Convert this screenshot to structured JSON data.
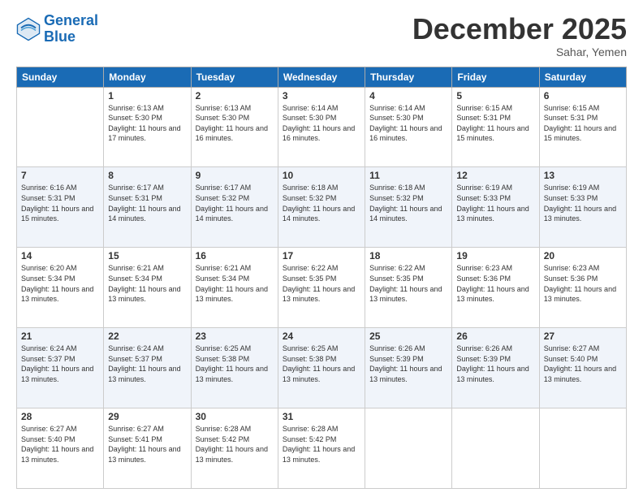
{
  "logo": {
    "line1": "General",
    "line2": "Blue"
  },
  "title": "December 2025",
  "subtitle": "Sahar, Yemen",
  "headers": [
    "Sunday",
    "Monday",
    "Tuesday",
    "Wednesday",
    "Thursday",
    "Friday",
    "Saturday"
  ],
  "weeks": [
    [
      {
        "day": "",
        "sunrise": "",
        "sunset": "",
        "daylight": ""
      },
      {
        "day": "1",
        "sunrise": "Sunrise: 6:13 AM",
        "sunset": "Sunset: 5:30 PM",
        "daylight": "Daylight: 11 hours and 17 minutes."
      },
      {
        "day": "2",
        "sunrise": "Sunrise: 6:13 AM",
        "sunset": "Sunset: 5:30 PM",
        "daylight": "Daylight: 11 hours and 16 minutes."
      },
      {
        "day": "3",
        "sunrise": "Sunrise: 6:14 AM",
        "sunset": "Sunset: 5:30 PM",
        "daylight": "Daylight: 11 hours and 16 minutes."
      },
      {
        "day": "4",
        "sunrise": "Sunrise: 6:14 AM",
        "sunset": "Sunset: 5:30 PM",
        "daylight": "Daylight: 11 hours and 16 minutes."
      },
      {
        "day": "5",
        "sunrise": "Sunrise: 6:15 AM",
        "sunset": "Sunset: 5:31 PM",
        "daylight": "Daylight: 11 hours and 15 minutes."
      },
      {
        "day": "6",
        "sunrise": "Sunrise: 6:15 AM",
        "sunset": "Sunset: 5:31 PM",
        "daylight": "Daylight: 11 hours and 15 minutes."
      }
    ],
    [
      {
        "day": "7",
        "sunrise": "Sunrise: 6:16 AM",
        "sunset": "Sunset: 5:31 PM",
        "daylight": "Daylight: 11 hours and 15 minutes."
      },
      {
        "day": "8",
        "sunrise": "Sunrise: 6:17 AM",
        "sunset": "Sunset: 5:31 PM",
        "daylight": "Daylight: 11 hours and 14 minutes."
      },
      {
        "day": "9",
        "sunrise": "Sunrise: 6:17 AM",
        "sunset": "Sunset: 5:32 PM",
        "daylight": "Daylight: 11 hours and 14 minutes."
      },
      {
        "day": "10",
        "sunrise": "Sunrise: 6:18 AM",
        "sunset": "Sunset: 5:32 PM",
        "daylight": "Daylight: 11 hours and 14 minutes."
      },
      {
        "day": "11",
        "sunrise": "Sunrise: 6:18 AM",
        "sunset": "Sunset: 5:32 PM",
        "daylight": "Daylight: 11 hours and 14 minutes."
      },
      {
        "day": "12",
        "sunrise": "Sunrise: 6:19 AM",
        "sunset": "Sunset: 5:33 PM",
        "daylight": "Daylight: 11 hours and 13 minutes."
      },
      {
        "day": "13",
        "sunrise": "Sunrise: 6:19 AM",
        "sunset": "Sunset: 5:33 PM",
        "daylight": "Daylight: 11 hours and 13 minutes."
      }
    ],
    [
      {
        "day": "14",
        "sunrise": "Sunrise: 6:20 AM",
        "sunset": "Sunset: 5:34 PM",
        "daylight": "Daylight: 11 hours and 13 minutes."
      },
      {
        "day": "15",
        "sunrise": "Sunrise: 6:21 AM",
        "sunset": "Sunset: 5:34 PM",
        "daylight": "Daylight: 11 hours and 13 minutes."
      },
      {
        "day": "16",
        "sunrise": "Sunrise: 6:21 AM",
        "sunset": "Sunset: 5:34 PM",
        "daylight": "Daylight: 11 hours and 13 minutes."
      },
      {
        "day": "17",
        "sunrise": "Sunrise: 6:22 AM",
        "sunset": "Sunset: 5:35 PM",
        "daylight": "Daylight: 11 hours and 13 minutes."
      },
      {
        "day": "18",
        "sunrise": "Sunrise: 6:22 AM",
        "sunset": "Sunset: 5:35 PM",
        "daylight": "Daylight: 11 hours and 13 minutes."
      },
      {
        "day": "19",
        "sunrise": "Sunrise: 6:23 AM",
        "sunset": "Sunset: 5:36 PM",
        "daylight": "Daylight: 11 hours and 13 minutes."
      },
      {
        "day": "20",
        "sunrise": "Sunrise: 6:23 AM",
        "sunset": "Sunset: 5:36 PM",
        "daylight": "Daylight: 11 hours and 13 minutes."
      }
    ],
    [
      {
        "day": "21",
        "sunrise": "Sunrise: 6:24 AM",
        "sunset": "Sunset: 5:37 PM",
        "daylight": "Daylight: 11 hours and 13 minutes."
      },
      {
        "day": "22",
        "sunrise": "Sunrise: 6:24 AM",
        "sunset": "Sunset: 5:37 PM",
        "daylight": "Daylight: 11 hours and 13 minutes."
      },
      {
        "day": "23",
        "sunrise": "Sunrise: 6:25 AM",
        "sunset": "Sunset: 5:38 PM",
        "daylight": "Daylight: 11 hours and 13 minutes."
      },
      {
        "day": "24",
        "sunrise": "Sunrise: 6:25 AM",
        "sunset": "Sunset: 5:38 PM",
        "daylight": "Daylight: 11 hours and 13 minutes."
      },
      {
        "day": "25",
        "sunrise": "Sunrise: 6:26 AM",
        "sunset": "Sunset: 5:39 PM",
        "daylight": "Daylight: 11 hours and 13 minutes."
      },
      {
        "day": "26",
        "sunrise": "Sunrise: 6:26 AM",
        "sunset": "Sunset: 5:39 PM",
        "daylight": "Daylight: 11 hours and 13 minutes."
      },
      {
        "day": "27",
        "sunrise": "Sunrise: 6:27 AM",
        "sunset": "Sunset: 5:40 PM",
        "daylight": "Daylight: 11 hours and 13 minutes."
      }
    ],
    [
      {
        "day": "28",
        "sunrise": "Sunrise: 6:27 AM",
        "sunset": "Sunset: 5:40 PM",
        "daylight": "Daylight: 11 hours and 13 minutes."
      },
      {
        "day": "29",
        "sunrise": "Sunrise: 6:27 AM",
        "sunset": "Sunset: 5:41 PM",
        "daylight": "Daylight: 11 hours and 13 minutes."
      },
      {
        "day": "30",
        "sunrise": "Sunrise: 6:28 AM",
        "sunset": "Sunset: 5:42 PM",
        "daylight": "Daylight: 11 hours and 13 minutes."
      },
      {
        "day": "31",
        "sunrise": "Sunrise: 6:28 AM",
        "sunset": "Sunset: 5:42 PM",
        "daylight": "Daylight: 11 hours and 13 minutes."
      },
      {
        "day": "",
        "sunrise": "",
        "sunset": "",
        "daylight": ""
      },
      {
        "day": "",
        "sunrise": "",
        "sunset": "",
        "daylight": ""
      },
      {
        "day": "",
        "sunrise": "",
        "sunset": "",
        "daylight": ""
      }
    ]
  ]
}
